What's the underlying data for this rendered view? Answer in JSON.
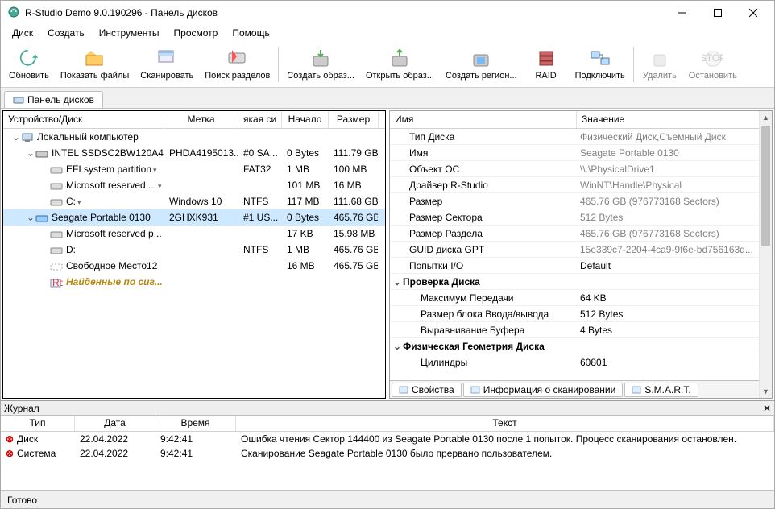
{
  "window": {
    "title": "R-Studio Demo 9.0.190296 - Панель дисков"
  },
  "menu": [
    "Диск",
    "Создать",
    "Инструменты",
    "Просмотр",
    "Помощь"
  ],
  "toolbar": [
    {
      "id": "refresh",
      "label": "Обновить"
    },
    {
      "id": "show",
      "label": "Показать файлы"
    },
    {
      "id": "scan",
      "label": "Сканировать"
    },
    {
      "id": "findpart",
      "label": "Поиск разделов"
    },
    {
      "id": "sep"
    },
    {
      "id": "mkimg",
      "label": "Создать образ..."
    },
    {
      "id": "openimg",
      "label": "Открыть образ..."
    },
    {
      "id": "mkreg",
      "label": "Создать регион..."
    },
    {
      "id": "raid",
      "label": "RAID"
    },
    {
      "id": "connect",
      "label": "Подключить"
    },
    {
      "id": "sep"
    },
    {
      "id": "delete",
      "label": "Удалить",
      "disabled": true
    },
    {
      "id": "stop",
      "label": "Остановить",
      "disabled": true
    }
  ],
  "tab_panel": "Панель дисков",
  "left_headers": [
    "Устройство/Диск",
    "Метка",
    "якая си",
    "Начало",
    "Размер"
  ],
  "tree": [
    {
      "indent": 0,
      "exp": "v",
      "icon": "pc",
      "name": "Локальный компьютер",
      "c2": "",
      "c3": "",
      "c4": "",
      "c5": ""
    },
    {
      "indent": 1,
      "exp": "v",
      "icon": "ssd",
      "name": "INTEL SSDSC2BW120A4 ...",
      "c2": "PHDA4195013...",
      "c3": "#0 SA...",
      "c4": "0 Bytes",
      "c5": "111.79 GB"
    },
    {
      "indent": 2,
      "exp": "",
      "icon": "part",
      "name": "EFI system partition",
      "dd": true,
      "c2": "",
      "c3": "FAT32",
      "c4": "1 MB",
      "c5": "100 MB"
    },
    {
      "indent": 2,
      "exp": "",
      "icon": "part",
      "name": "Microsoft reserved ...",
      "dd": true,
      "c2": "",
      "c3": "",
      "c4": "101 MB",
      "c5": "16 MB"
    },
    {
      "indent": 2,
      "exp": "",
      "icon": "part",
      "name": "C:",
      "dd": true,
      "c2": "Windows 10",
      "c3": "NTFS",
      "c4": "117 MB",
      "c5": "111.68 GB"
    },
    {
      "indent": 1,
      "exp": "v",
      "icon": "hdd",
      "name": "Seagate Portable 0130",
      "sel": true,
      "c2": "2GHXK931",
      "c3": "#1 US...",
      "c4": "0 Bytes",
      "c5": "465.76 GB"
    },
    {
      "indent": 2,
      "exp": "",
      "icon": "part",
      "name": "Microsoft reserved p...",
      "c2": "",
      "c3": "",
      "c4": "17 KB",
      "c5": "15.98 MB"
    },
    {
      "indent": 2,
      "exp": "",
      "icon": "part",
      "name": "D:",
      "c2": "",
      "c3": "NTFS",
      "c4": "1 MB",
      "c5": "465.76 GB"
    },
    {
      "indent": 2,
      "exp": "",
      "icon": "free",
      "name": "Свободное Место12",
      "c2": "",
      "c3": "",
      "c4": "16 MB",
      "c5": "465.75 GB"
    },
    {
      "indent": 2,
      "exp": "",
      "icon": "sig",
      "name": "Найденные по сиг...",
      "gold": true,
      "c2": "",
      "c3": "",
      "c4": "",
      "c5": ""
    }
  ],
  "right_headers": [
    "Имя",
    "Значение"
  ],
  "props": [
    {
      "n": "Тип Диска",
      "v": "Физический Диск,Съемный Диск",
      "i": 1
    },
    {
      "n": "Имя",
      "v": "Seagate Portable 0130",
      "i": 1
    },
    {
      "n": "Объект ОС",
      "v": "\\\\.\\PhysicalDrive1",
      "i": 1
    },
    {
      "n": "Драйвер R-Studio",
      "v": "WinNT\\Handle\\Physical",
      "i": 1
    },
    {
      "n": "Размер",
      "v": "465.76 GB (976773168 Sectors)",
      "i": 1
    },
    {
      "n": "Размер Сектора",
      "v": "512 Bytes",
      "i": 1
    },
    {
      "n": "Размер Раздела",
      "v": "465.76 GB (976773168 Sectors)",
      "i": 1
    },
    {
      "n": "GUID диска GPT",
      "v": "15e339c7-2204-4ca9-9f6e-bd756163d...",
      "i": 1
    },
    {
      "n": "Попытки I/O",
      "v": "Default",
      "i": 1,
      "dd": true,
      "dark": true
    },
    {
      "group": true,
      "n": "Проверка Диска",
      "v": "",
      "exp": "v"
    },
    {
      "n": "Максимум Передачи",
      "v": "64 KB",
      "i": 2,
      "dd": true,
      "dark": true
    },
    {
      "n": "Размер блока Ввода/вывода",
      "v": "512 Bytes",
      "i": 2,
      "dd": true,
      "dark": true
    },
    {
      "n": "Выравнивание Буфера",
      "v": "4 Bytes",
      "i": 2,
      "dd": true,
      "dark": true
    },
    {
      "group": true,
      "n": "Физическая Геометрия Диска",
      "v": "",
      "exp": "v"
    },
    {
      "n": "Цилиндры",
      "v": "60801",
      "i": 2,
      "dark": true
    }
  ],
  "bottom_tabs": [
    {
      "id": "props",
      "label": "Свойства",
      "active": true
    },
    {
      "id": "scaninfo",
      "label": "Информация о сканировании"
    },
    {
      "id": "smart",
      "label": "S.M.A.R.T."
    }
  ],
  "log": {
    "title": "Журнал",
    "headers": [
      "Тип",
      "Дата",
      "Время",
      "Текст"
    ],
    "rows": [
      {
        "type": "Диск",
        "date": "22.04.2022",
        "time": "9:42:41",
        "text": "Ошибка чтения Сектор 144400 из Seagate Portable 0130 после 1 попыток. Процесс сканирования остановлен."
      },
      {
        "type": "Система",
        "date": "22.04.2022",
        "time": "9:42:41",
        "text": "Сканирование Seagate Portable 0130 было прервано пользователем."
      }
    ]
  },
  "status": "Готово"
}
